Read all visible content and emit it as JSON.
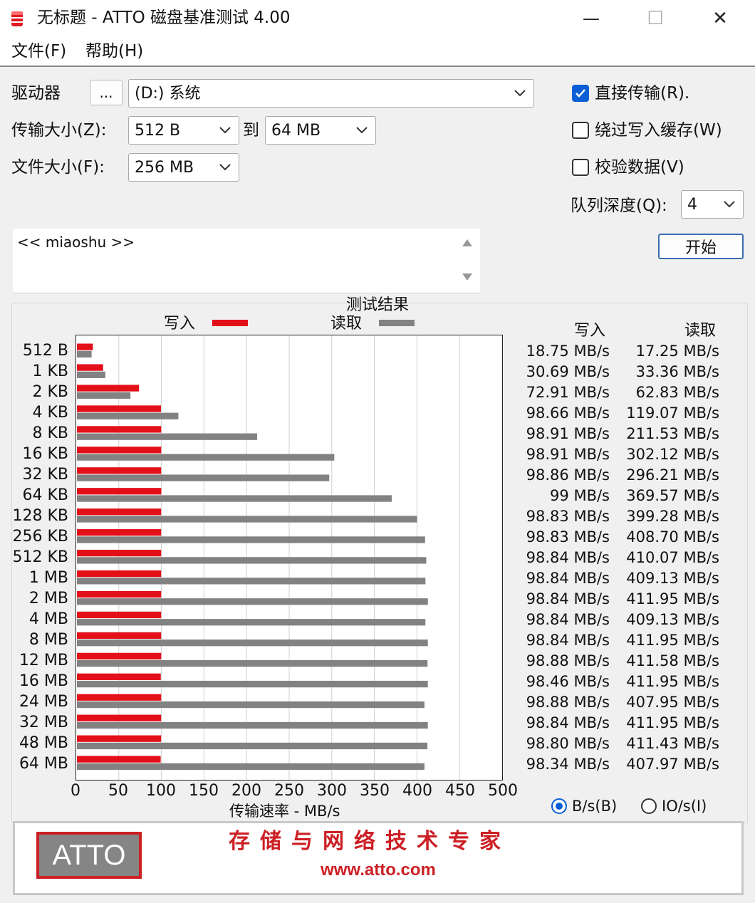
{
  "window": {
    "title": "无标题 - ATTO 磁盘基准测试 4.00",
    "minimize_glyph": "—",
    "maximize_glyph": "☐",
    "close_glyph": "✕"
  },
  "menu": {
    "file": "文件(F)",
    "help": "帮助(H)"
  },
  "controls": {
    "drive_label": "驱动器",
    "browse_label": "...",
    "drive_value": "(D:) 系统",
    "transfer_label": "传输大小(Z):",
    "transfer_from": "512 B",
    "to_label": "到",
    "transfer_to": "64 MB",
    "filesize_label": "文件大小(F):",
    "filesize_value": "256 MB",
    "direct_io_label": "直接传输(R).",
    "direct_io_checked": true,
    "bypass_cache_label": "绕过写入缓存(W)",
    "bypass_cache_checked": false,
    "verify_label": "校验数据(V)",
    "verify_checked": false,
    "queue_label": "队列深度(Q):",
    "queue_value": "4",
    "start_label": "开始",
    "description": "<< miaoshu >>"
  },
  "results": {
    "title": "测试结果",
    "write_legend": "写入",
    "read_legend": "读取",
    "write_header": "写入",
    "read_header": "读取",
    "units": {
      "bytes": "B/s(B)",
      "io": "IO/s(I)",
      "selected": "bytes"
    }
  },
  "chart_data": {
    "type": "bar",
    "orientation": "horizontal",
    "title": "测试结果",
    "xlabel": "传输速率 - MB/s",
    "xlim": [
      0,
      500
    ],
    "xticks": [
      "0",
      "50",
      "100",
      "150",
      "200",
      "250",
      "300",
      "350",
      "400",
      "450",
      "500"
    ],
    "grid": true,
    "categories": [
      "512 B",
      "1 KB",
      "2 KB",
      "4 KB",
      "8 KB",
      "16 KB",
      "32 KB",
      "64 KB",
      "128 KB",
      "256 KB",
      "512 KB",
      "1 MB",
      "2 MB",
      "4 MB",
      "8 MB",
      "12 MB",
      "16 MB",
      "24 MB",
      "32 MB",
      "48 MB",
      "64 MB"
    ],
    "series": [
      {
        "name": "写入",
        "color": "#e3101a",
        "values": [
          18.75,
          30.69,
          72.91,
          98.66,
          98.91,
          98.91,
          98.86,
          99,
          98.83,
          98.83,
          98.84,
          98.84,
          98.84,
          98.84,
          98.84,
          98.88,
          98.46,
          98.88,
          98.84,
          98.8,
          98.34
        ],
        "labels": [
          "18.75 MB/s",
          "30.69 MB/s",
          "72.91 MB/s",
          "98.66 MB/s",
          "98.91 MB/s",
          "98.91 MB/s",
          "98.86 MB/s",
          "99 MB/s",
          "98.83 MB/s",
          "98.83 MB/s",
          "98.84 MB/s",
          "98.84 MB/s",
          "98.84 MB/s",
          "98.84 MB/s",
          "98.84 MB/s",
          "98.88 MB/s",
          "98.46 MB/s",
          "98.88 MB/s",
          "98.84 MB/s",
          "98.80 MB/s",
          "98.34 MB/s"
        ]
      },
      {
        "name": "读取",
        "color": "#828282",
        "values": [
          17.25,
          33.36,
          62.83,
          119.07,
          211.53,
          302.12,
          296.21,
          369.57,
          399.28,
          408.7,
          410.07,
          409.13,
          411.95,
          409.13,
          411.95,
          411.58,
          411.95,
          407.95,
          411.95,
          411.43,
          407.97
        ],
        "labels": [
          "17.25 MB/s",
          "33.36 MB/s",
          "62.83 MB/s",
          "119.07 MB/s",
          "211.53 MB/s",
          "302.12 MB/s",
          "296.21 MB/s",
          "369.57 MB/s",
          "399.28 MB/s",
          "408.70 MB/s",
          "410.07 MB/s",
          "409.13 MB/s",
          "411.95 MB/s",
          "409.13 MB/s",
          "411.95 MB/s",
          "411.58 MB/s",
          "411.95 MB/s",
          "407.95 MB/s",
          "411.95 MB/s",
          "411.43 MB/s",
          "407.97 MB/s"
        ]
      }
    ]
  },
  "footer": {
    "logo": "ATTO",
    "slogan": "存储与网络技术专家",
    "website": "www.atto.com",
    "brand_color": "#cc1f24"
  }
}
